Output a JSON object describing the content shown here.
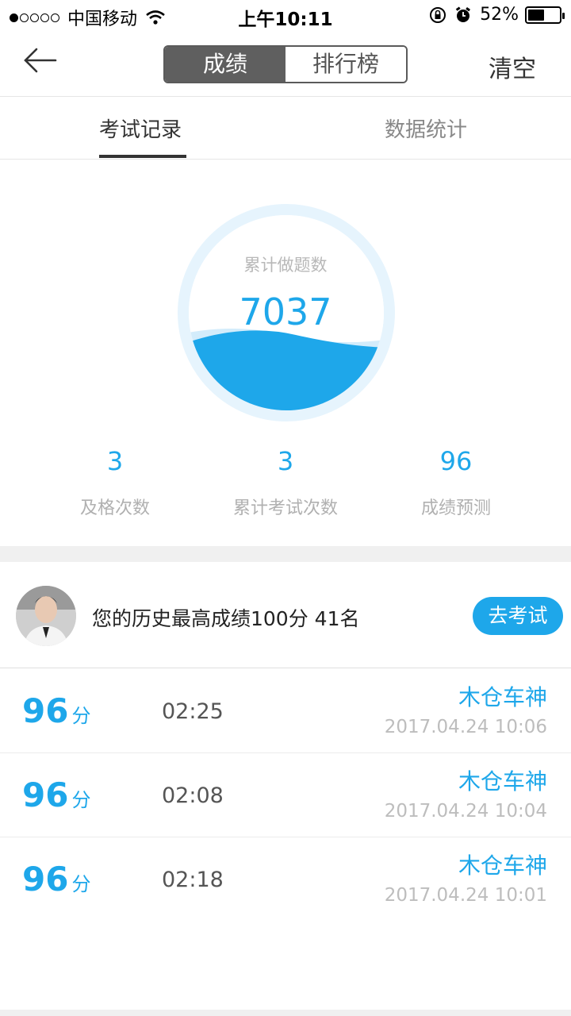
{
  "status_bar": {
    "carrier": "中国移动",
    "time": "上午10:11",
    "battery_percent": "52%",
    "battery_level": 0.52,
    "icons": [
      "signal-dots-icon",
      "wifi-icon",
      "orientation-lock-icon",
      "alarm-icon",
      "battery-icon"
    ]
  },
  "nav": {
    "back_icon": "arrow-left-icon",
    "segments": [
      "成绩",
      "排行榜"
    ],
    "active_segment": 0,
    "clear_label": "清空"
  },
  "tabs": {
    "records": "考试记录",
    "stats": "数据统计",
    "active": "records"
  },
  "gauge": {
    "label": "累计做题数",
    "value": "7037"
  },
  "stats": [
    {
      "value": "3",
      "label": "及格次数"
    },
    {
      "value": "3",
      "label": "累计考试次数"
    },
    {
      "value": "96",
      "label": "成绩预测"
    }
  ],
  "history": {
    "text": "您的历史最高成绩100分  41名",
    "button_label": "去考试"
  },
  "records": [
    {
      "score": "96",
      "unit": "分",
      "duration": "02:25",
      "user": "木仓车神",
      "date": "2017.04.24 10:06"
    },
    {
      "score": "96",
      "unit": "分",
      "duration": "02:08",
      "user": "木仓车神",
      "date": "2017.04.24 10:04"
    },
    {
      "score": "96",
      "unit": "分",
      "duration": "02:18",
      "user": "木仓车神",
      "date": "2017.04.24 10:01"
    }
  ],
  "colors": {
    "accent": "#1ea7ea",
    "segment_active": "#5f5f5f",
    "muted_text": "#b0b0b0"
  }
}
